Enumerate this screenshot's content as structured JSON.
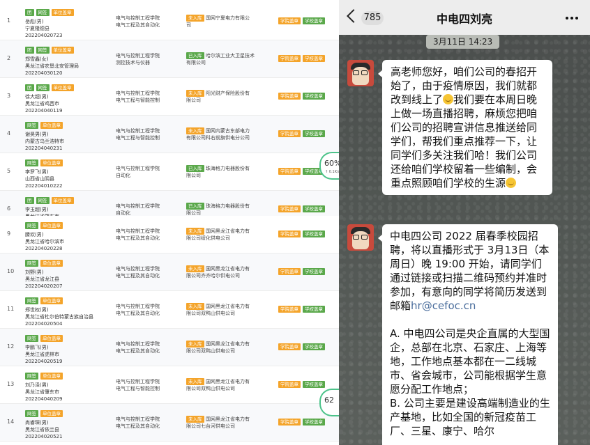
{
  "table": {
    "rows": [
      {
        "no": "1",
        "tags": [
          {
            "t": "团",
            "c": "g"
          },
          {
            "t": "网签",
            "c": "g"
          },
          {
            "t": "单位盖章",
            "c": "o"
          }
        ],
        "name": "岳彪(男)",
        "origin": "宁夏隆德县",
        "sid": "202204020723",
        "school": [
          "电气与控制工程学院",
          "电气工程及其自动化"
        ],
        "status": "未入库",
        "status_color": "o",
        "company": [
          "国网宁夏电力有限公",
          "司"
        ],
        "btns": [
          {
            "t": "学院盖章",
            "c": "o"
          },
          {
            "t": "学校盖章",
            "c": "g"
          }
        ]
      },
      {
        "no": "2",
        "tags": [
          {
            "t": "团",
            "c": "g"
          },
          {
            "t": "网签",
            "c": "g"
          },
          {
            "t": "单位盖章",
            "c": "o"
          }
        ],
        "name": "郑雪鑫(女)",
        "origin": "黑龙江省农垦北安管理局",
        "sid": "202204030120",
        "school": [
          "电气与控制工程学院",
          "测控技术与仪器"
        ],
        "status": "已入库",
        "status_color": "g",
        "company": [
          "哈尔滨工业大卫星技术",
          "有限公司"
        ],
        "btns": [
          {
            "t": "学院盖章",
            "c": "o"
          },
          {
            "t": "学校盖章",
            "c": "o"
          }
        ]
      },
      {
        "no": "3",
        "tags": [
          {
            "t": "团",
            "c": "g"
          },
          {
            "t": "网签",
            "c": "g"
          },
          {
            "t": "单位盖章",
            "c": "o"
          }
        ],
        "name": "徐大超(男)",
        "origin": "黑龙江省鸡西市",
        "sid": "202204040119",
        "school": [
          "电气与控制工程学院",
          "电气工程与智能控制"
        ],
        "status": "未入库",
        "status_color": "o",
        "company": [
          "阳光财产保险股份有",
          "限公司"
        ],
        "btns": [
          {
            "t": "学院盖章",
            "c": "o"
          },
          {
            "t": "学校盖章",
            "c": "g"
          }
        ]
      },
      {
        "no": "4",
        "tags": [
          {
            "t": "网签",
            "c": "g"
          },
          {
            "t": "单位盖章",
            "c": "o"
          }
        ],
        "name": "谢昊男(男)",
        "origin": "内蒙古乌兰浩特市",
        "sid": "202204040231",
        "school": [
          "电气与控制工程学院",
          "电气工程与智能控制"
        ],
        "status": "未入库",
        "status_color": "o",
        "company": [
          "国网内蒙古东部电力",
          "有限公司科右前旗供电分公司"
        ],
        "btns": [
          {
            "t": "学院盖章",
            "c": "o"
          },
          {
            "t": "学校盖章",
            "c": "g"
          }
        ]
      },
      {
        "no": "5",
        "tags": [
          {
            "t": "网签",
            "c": "g"
          },
          {
            "t": "单位盖章",
            "c": "o"
          }
        ],
        "name": "李罗飞(男)",
        "origin": "山西省山阴县",
        "sid": "202204010222",
        "school": [
          "电气与控制工程学院",
          "自动化"
        ],
        "status": "已入库",
        "status_color": "g",
        "company": [
          "珠海格力电器股份有",
          "限公司"
        ],
        "btns": [
          {
            "t": "学院盖章",
            "c": "o"
          },
          {
            "t": "学校盖章",
            "c": "g"
          }
        ]
      },
      {
        "no": "6",
        "tags": [
          {
            "t": "团",
            "c": "g"
          },
          {
            "t": "网签",
            "c": "g"
          },
          {
            "t": "单位盖章",
            "c": "o"
          }
        ],
        "name": "李玉超(男)",
        "origin": "黑龙江省肇东市",
        "sid": "",
        "school": [
          "电气与控制工程学院",
          "自动化"
        ],
        "status": "已入库",
        "status_color": "g",
        "company": [
          "珠海格力电器股份有",
          "限公司"
        ],
        "btns": [
          {
            "t": "学院盖章",
            "c": "o"
          },
          {
            "t": "学校盖章",
            "c": "g"
          }
        ]
      },
      {
        "no": "9",
        "tags": [
          {
            "t": "网签",
            "c": "g"
          },
          {
            "t": "单位盖章",
            "c": "o"
          }
        ],
        "name": "滕欢(男)",
        "origin": "黑龙江省哈尔滨市",
        "sid": "202204020228",
        "school": [
          "电气与控制工程学院",
          "电气工程及其自动化"
        ],
        "status": "未入库",
        "status_color": "o",
        "company": [
          "国网黑龙江省电力有",
          "限公司绥化供电公司"
        ],
        "btns": [
          {
            "t": "学院盖章",
            "c": "o"
          },
          {
            "t": "学校盖章",
            "c": "g"
          }
        ]
      },
      {
        "no": "10",
        "tags": [
          {
            "t": "网签",
            "c": "g"
          },
          {
            "t": "单位盖章",
            "c": "o"
          }
        ],
        "name": "刘野(男)",
        "origin": "黑龙江省龙江县",
        "sid": "202204020207",
        "school": [
          "电气与控制工程学院",
          "电气工程及其自动化"
        ],
        "status": "未入库",
        "status_color": "o",
        "company": [
          "国网黑龙江省电力有",
          "限公司齐齐哈尔供电公司"
        ],
        "btns": [
          {
            "t": "学院盖章",
            "c": "o"
          },
          {
            "t": "学校盖章",
            "c": "g"
          }
        ]
      },
      {
        "no": "11",
        "tags": [
          {
            "t": "网签",
            "c": "g"
          },
          {
            "t": "单位盖章",
            "c": "o"
          }
        ],
        "name": "郑世权(男)",
        "origin": "黑龙江省杜尔伯特蒙古族自治县",
        "sid": "202204020504",
        "school": [
          "电气与控制工程学院",
          "电气工程及其自动化"
        ],
        "status": "未入库",
        "status_color": "o",
        "company": [
          "国网黑龙江省电力有",
          "限公司双鸭山供电公司"
        ],
        "btns": [
          {
            "t": "学院盖章",
            "c": "o"
          },
          {
            "t": "学校盖章",
            "c": "g"
          }
        ]
      },
      {
        "no": "12",
        "tags": [
          {
            "t": "网签",
            "c": "g"
          },
          {
            "t": "单位盖章",
            "c": "o"
          }
        ],
        "name": "李鹏飞(男)",
        "origin": "黑龙江省虎林市",
        "sid": "202204020519",
        "school": [
          "电气与控制工程学院",
          "电气工程及其自动化"
        ],
        "status": "未入库",
        "status_color": "o",
        "company": [
          "国网黑龙江省电力有",
          "限公司双鸭山供电公司"
        ],
        "btns": [
          {
            "t": "学院盖章",
            "c": "o"
          },
          {
            "t": "学校盖章",
            "c": "g"
          }
        ]
      },
      {
        "no": "13",
        "tags": [
          {
            "t": "网签",
            "c": "g"
          },
          {
            "t": "单位盖章",
            "c": "o"
          }
        ],
        "name": "刘乃泽(男)",
        "origin": "黑龙江省肇东市",
        "sid": "202204040209",
        "school": [
          "电气与控制工程学院",
          "电气工程与智能控制"
        ],
        "status": "未入库",
        "status_color": "o",
        "company": [
          "国网黑龙江省电力有",
          "限公司双鸭山供电公司"
        ],
        "btns": [
          {
            "t": "学院盖章",
            "c": "o"
          },
          {
            "t": "学校盖章",
            "c": "g"
          }
        ]
      },
      {
        "no": "14",
        "tags": [
          {
            "t": "网签",
            "c": "g"
          },
          {
            "t": "单位盖章",
            "c": "o"
          }
        ],
        "name": "尚睿琛(男)",
        "origin": "黑龙江省依兰县",
        "sid": "202204020521",
        "school": [
          "电气与控制工程学院",
          "电气工程及其自动化"
        ],
        "status": "未入库",
        "status_color": "o",
        "company": [
          "国网黑龙江省电力有",
          "限公司七台河供电公司"
        ],
        "btns": [
          {
            "t": "学院盖章",
            "c": "o"
          },
          {
            "t": "学校盖章",
            "c": "g"
          }
        ]
      }
    ],
    "gauge_top": {
      "pct": "60%",
      "speed": "↑ 0.1K/s"
    },
    "gauge_bottom": {
      "pct": "62",
      "speed": ""
    }
  },
  "chat": {
    "back_count": "785",
    "title": "中电四刘亮",
    "time": "3月11日 14:23",
    "msg1_a": "高老师您好，咱们公司的春招开始了，由于疫情原因，我们就都改到线上了",
    "msg1_b": "我们要在本周日晚上做一场直播招聘，麻烦您把咱们公司的招聘宣讲信息推送给同学们，帮我们重点推荐一下，让同学们多关注我们哈！我们公司还给咱们学校留着一些编制，会重点照顾咱们学校的生源",
    "msg2_a": "中电四公司 2022 届春季校园招聘，将以直播形式于 3月13日（本周日）晚 19:00 开始，请同学们通过链接或扫描二维码预约并准时参加，有意向的同学将简历发送到邮箱",
    "msg2_email": "hr@cefoc.cn",
    "msg2_p1": "A.  中电四公司是央企直属的大型国企，总部在北京、石家庄、上海等地，工作地点基本都在一二线城市、省会城市，公司能根据学生意愿分配工作地点；",
    "msg2_p2": "B.  公司主要是建设高端制造业的生产基地，比如全国的新冠疫苗工厂、三星、康宁、哈尔"
  }
}
